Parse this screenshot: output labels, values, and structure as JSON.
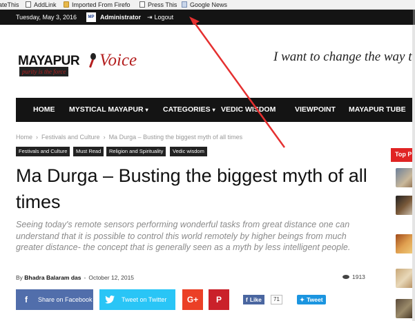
{
  "bookmarks": [
    {
      "label": "ateThis",
      "icon": "page-icon"
    },
    {
      "label": "AddLink",
      "icon": "page-icon"
    },
    {
      "label": "Imported From Firefo",
      "icon": "folder-icon"
    },
    {
      "label": "Press This",
      "icon": "page-icon"
    },
    {
      "label": "Google News",
      "icon": "news-icon"
    }
  ],
  "topbar": {
    "date": "Tuesday, May 3, 2016",
    "avatar_text": "MP",
    "user": "Administrator",
    "logout": "Logout"
  },
  "logo": {
    "name_part1": "MAYAPUR",
    "name_part2": "Voice",
    "tagline": "purity is the force"
  },
  "header_quote": "I want to change the way the",
  "nav": {
    "items": [
      {
        "label": "HOME"
      },
      {
        "label": "MYSTICAL MAYAPUR",
        "has_dropdown": true
      },
      {
        "label": "CATEGORIES",
        "has_dropdown": true
      },
      {
        "label": "VEDIC WISDOM"
      },
      {
        "label": "VIEWPOINT"
      },
      {
        "label": "MAYAPUR TUBE"
      }
    ]
  },
  "breadcrumb": [
    "Home",
    "Festivals and Culture",
    "Ma Durga – Busting the biggest myth of all times"
  ],
  "tags": [
    "Festivals and Culture",
    "Must Read",
    "Religion and Spirituality",
    "Vedic wisdom"
  ],
  "article": {
    "title": "Ma Durga – Busting the biggest myth of all times",
    "subtitle": "Seeing today's remote sensors performing wonderful tasks from great distance one can understand that it is possible to control this world remotely by higher beings from much greater distance- the concept that is generally seen as a myth by less intelligent people.",
    "by": "By",
    "author": "Bhadra Balaram das",
    "dash": "-",
    "date": "October 12, 2015",
    "views": "1913"
  },
  "share": {
    "facebook": "Share on Facebook",
    "twitter": "Tweet on Twitter",
    "gplus": "G+",
    "pinterest": "P",
    "fb_like": "Like",
    "fb_count": "71",
    "tweet": "Tweet"
  },
  "sidebar": {
    "label": "Top P"
  },
  "colors": {
    "accent_red": "#e02424",
    "brand_red": "#b41f1f",
    "facebook": "#516eab",
    "twitter": "#29c5f6",
    "gplus": "#eb4026",
    "pinterest": "#ca212a",
    "dark_bar": "#141414"
  }
}
